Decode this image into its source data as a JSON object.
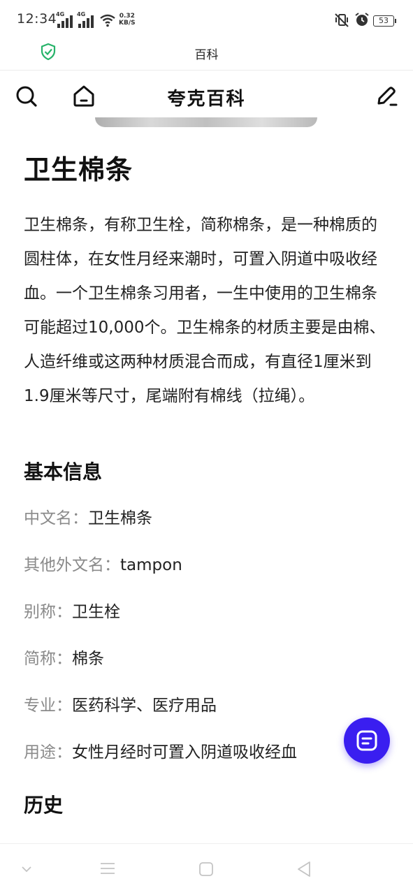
{
  "status_bar": {
    "time": "12:34",
    "network_1": "4G",
    "network_2": "4G",
    "speed_value": "0.32",
    "speed_unit": "KB/S",
    "battery": "53"
  },
  "title_bar": {
    "title": "百科"
  },
  "header": {
    "title": "夸克百科"
  },
  "article": {
    "title": "卫生棉条",
    "intro": "卫生棉条，有称卫生栓，简称棉条，是一种棉质的圆柱体，在女性月经来潮时，可置入阴道中吸收经血。一个卫生棉条习用者，一生中使用的卫生棉条可能超过10,000个。卫生棉条的材质主要是由棉、人造纤维或这两种材质混合而成，有直径1厘米到1.9厘米等尺寸，尾端附有棉线（拉绳）。",
    "basic_info_heading": "基本信息",
    "info": [
      {
        "key": "中文名：",
        "value": "卫生棉条"
      },
      {
        "key": "其他外文名：",
        "value": "tampon"
      },
      {
        "key": "别称：",
        "value": "卫生栓"
      },
      {
        "key": "简称：",
        "value": "棉条"
      },
      {
        "key": "专业：",
        "value": "医药科学、医疗用品"
      },
      {
        "key": "用途：",
        "value": "女性月经时可置入阴道吸收经血"
      }
    ],
    "history_heading": "历史"
  },
  "icons": {
    "shield": "shield-check-icon",
    "search": "search-icon",
    "home": "home-icon",
    "edit": "edit-icon",
    "fab": "notes-icon"
  },
  "colors": {
    "accent": "#3a1ef0",
    "shield": "#27b36a",
    "label_gray": "#8a8a8a"
  }
}
